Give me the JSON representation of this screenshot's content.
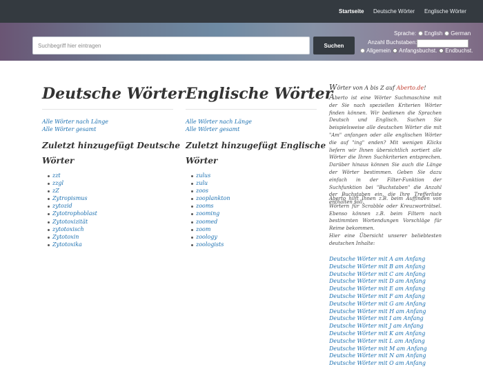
{
  "nav": {
    "items": [
      {
        "label": "Startseite",
        "active": true
      },
      {
        "label": "Deutsche Wörter",
        "active": false
      },
      {
        "label": "Englische Wörter",
        "active": false
      }
    ]
  },
  "search": {
    "placeholder": "Suchbegriff hier eintragen",
    "button_label": "Suchen",
    "language_label": "Sprache:",
    "language_options": [
      "English",
      "German"
    ],
    "count_label": "Anzahl Buchstaben:",
    "position_options": [
      "Allgemein",
      "Anfangsbuchst.",
      "Endbuchst."
    ]
  },
  "german": {
    "title": "Deutsche Wörter",
    "link_by_length": "Alle Wörter nach Länge",
    "link_all": "Alle Wörter gesamt",
    "recent_title_1": "Zuletzt hinzugefügt Deutsche",
    "recent_title_2": "Wörter",
    "words": [
      "zzt",
      "zzgl",
      "zZ",
      "Zytropismus",
      "zytozid",
      "Zytotrophoblast",
      "Zytotoxizität",
      "zytotoxisch",
      "Zytotoxin",
      "Zytotoxika"
    ]
  },
  "english": {
    "title": "Englische Wörter",
    "link_by_length": "Alle Wörter nach Länge",
    "link_all": "Alle Wörter gesamt",
    "recent_title_1": "Zuletzt hinzugefügt Englische",
    "recent_title_2": "Wörter",
    "words": [
      "zulus",
      "zulu",
      "zoos",
      "zooplankton",
      "zooms",
      "zooming",
      "zoomed",
      "zoom",
      "zoology",
      "zoologists"
    ]
  },
  "sidebar": {
    "head_cap": "W",
    "head_text": "örter von A bis Z auf ",
    "brand": "Aberto.de",
    "brand_suffix": "!",
    "para1_cap": "A",
    "para1": "berto ist eine Wörter Suchmaschine mit der Sie nach speziellen Kriterien Wörter finden können. Wir bedienen die Sprachen Deutsch und Englisch. Suchen Sie beispielsweise alle deutschen Wörter die mit \"Am\" anfangen oder alle englischen Wörter die auf \"ing\" enden? Mit wenigen Klicks liefern wir Ihnen übersichtlich sortiert alle Wörter die Ihren Suchkriterien entsprechen. Darüber hinaus können Sie auch die Länge der Wörter bestimmen. Geben Sie dazu einfach in der Filter-Funktion der Suchfunktion bei \"Buchstaben\" die Anzahl der Buchstaben ein, die Ihre Trefferliste enthalten soll.",
    "para2": "Aberto hilft Ihnen z.B. beim Auffinden von Wörtern für Scrabble oder Kreuzworträtsel. Ebenso können z.B. beim Filtern nach bestimmten Wortendungen Vorschläge für Reime bekommen.",
    "para3": "Hier eine Übersicht unserer beliebtesten deutschen Inhalte:",
    "links": [
      "Deutsche Wörter mit A am Anfang",
      "Deutsche Wörter mit B am Anfang",
      "Deutsche Wörter mit C am Anfang",
      "Deutsche Wörter mit D am Anfang",
      "Deutsche Wörter mit E am Anfang",
      "Deutsche Wörter mit F am Anfang",
      "Deutsche Wörter mit G am Anfang",
      "Deutsche Wörter mit H am Anfang",
      "Deutsche Wörter mit I am Anfang",
      "Deutsche Wörter mit J am Anfang",
      "Deutsche Wörter mit K am Anfang",
      "Deutsche Wörter mit L am Anfang",
      "Deutsche Wörter mit M am Anfang",
      "Deutsche Wörter mit N am Anfang",
      "Deutsche Wörter mit O am Anfang"
    ]
  }
}
